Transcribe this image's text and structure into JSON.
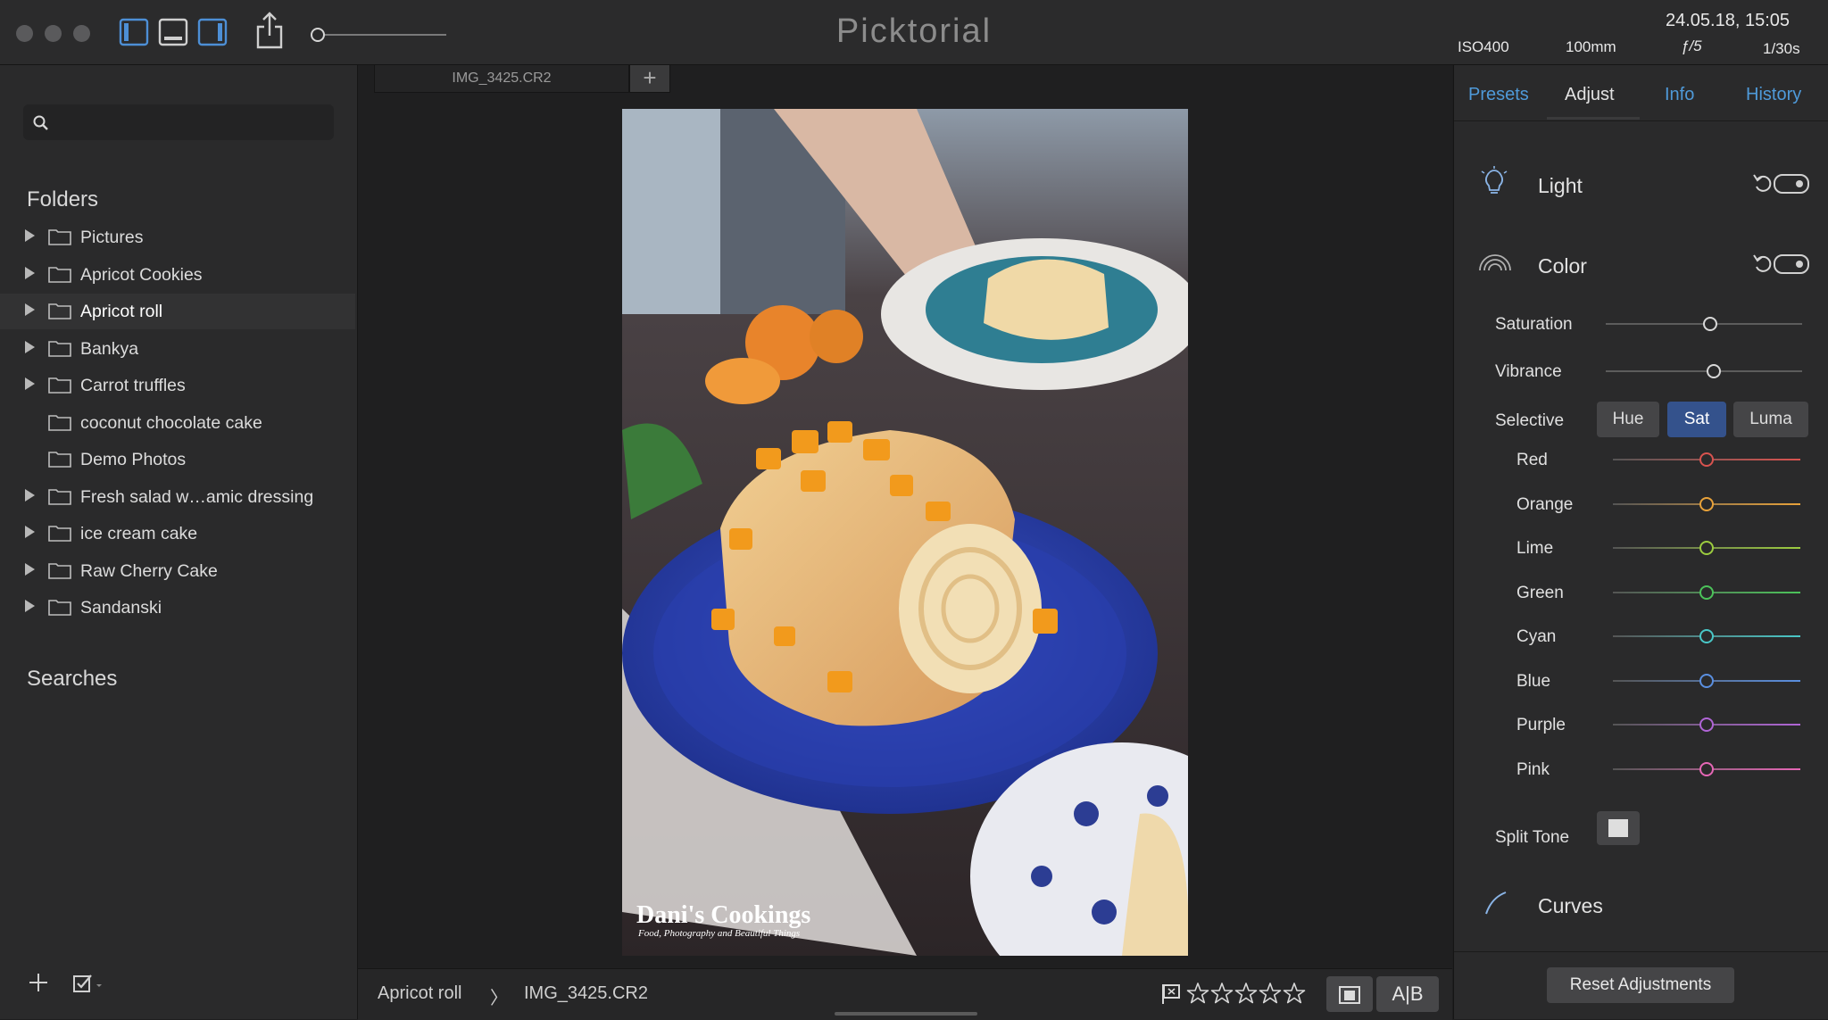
{
  "app": {
    "title": "Picktorial"
  },
  "toolbar": {
    "zoom": 0.0
  },
  "meta": {
    "datetime": "24.05.18, 15:05",
    "iso": "ISO400",
    "focal": "100mm",
    "aperture": "ƒ/5",
    "shutter": "1/30s"
  },
  "sidebar": {
    "search_placeholder": "",
    "folders_title": "Folders",
    "folders": [
      {
        "label": "Pictures",
        "expandable": true
      },
      {
        "label": "Apricot Cookies",
        "expandable": true
      },
      {
        "label": "Apricot roll",
        "expandable": true,
        "active": true
      },
      {
        "label": "Bankya",
        "expandable": true
      },
      {
        "label": "Carrot truffles",
        "expandable": true
      },
      {
        "label": "coconut chocolate cake",
        "expandable": false
      },
      {
        "label": "Demo Photos",
        "expandable": false
      },
      {
        "label": "Fresh salad w…amic dressing",
        "expandable": true
      },
      {
        "label": "ice cream cake",
        "expandable": true
      },
      {
        "label": "Raw Cherry Cake",
        "expandable": true
      },
      {
        "label": "Sandanski",
        "expandable": true
      }
    ],
    "searches_title": "Searches"
  },
  "main": {
    "tab_label": "IMG_3425.CR2",
    "tab_add": "+",
    "watermark_title": "Dani's Cookings",
    "watermark_sub": "Food, Photography and Beautiful Things",
    "breadcrumb_folder": "Apricot roll",
    "breadcrumb_sep": "〉",
    "breadcrumb_file": "IMG_3425.CR2",
    "rating": 0,
    "ab_label": "A|B"
  },
  "rpanel": {
    "tabs": [
      {
        "label": "Presets",
        "active": false
      },
      {
        "label": "Adjust",
        "active": true
      },
      {
        "label": "Info",
        "active": false
      },
      {
        "label": "History",
        "active": false
      }
    ],
    "light_title": "Light",
    "color_title": "Color",
    "saturation_label": "Saturation",
    "saturation_value": 0.53,
    "vibrance_label": "Vibrance",
    "vibrance_value": 0.55,
    "selective_label": "Selective",
    "selective_modes": [
      "Hue",
      "Sat",
      "Luma"
    ],
    "selective_selected": "Sat",
    "channels": [
      {
        "label": "Red",
        "color": "#d9534f",
        "value": 0.5
      },
      {
        "label": "Orange",
        "color": "#e8a23a",
        "value": 0.5
      },
      {
        "label": "Lime",
        "color": "#9ccc3f",
        "value": 0.5
      },
      {
        "label": "Green",
        "color": "#4cc35a",
        "value": 0.5
      },
      {
        "label": "Cyan",
        "color": "#49c7c7",
        "value": 0.5
      },
      {
        "label": "Blue",
        "color": "#5a8fe0",
        "value": 0.5
      },
      {
        "label": "Purple",
        "color": "#b065d6",
        "value": 0.5
      },
      {
        "label": "Pink",
        "color": "#e667b6",
        "value": 0.5
      }
    ],
    "split_tone_label": "Split Tone",
    "curves_title": "Curves",
    "reset_label": "Reset Adjustments"
  }
}
